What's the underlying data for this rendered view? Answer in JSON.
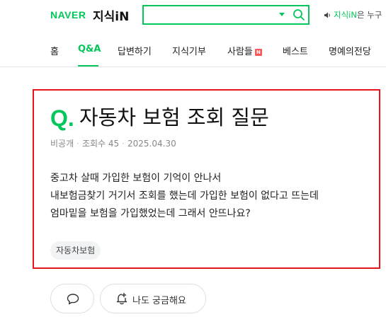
{
  "header": {
    "logo_brand": "NAVER",
    "logo_service": "지식iN",
    "search": {
      "value": "",
      "placeholder": ""
    },
    "notice": {
      "part1": "지식iN",
      "part2": "은 누구"
    }
  },
  "nav": {
    "items": [
      {
        "label": "홈",
        "active": false
      },
      {
        "label": "Q&A",
        "active": true
      },
      {
        "label": "답변하기",
        "active": false
      },
      {
        "label": "지식기부",
        "active": false
      },
      {
        "label": "사람들",
        "active": false,
        "badge": "N"
      },
      {
        "label": "베스트",
        "active": false
      },
      {
        "label": "명예의전당",
        "active": false
      }
    ]
  },
  "question": {
    "mark": "Q.",
    "title": "자동차 보험 조회 질문",
    "meta": {
      "author": "비공개",
      "views": "조회수 45",
      "date": "2025.04.30"
    },
    "body": "중고차 살때 가입한 보험이 기억이 안나서\n내보험금찾기 거기서 조회를 했는데 가입한 보험이 없다고 뜨는데\n엄마밑을 보험을 가입했었는데 그래서 안뜨나요?",
    "tag": "자동차보험"
  },
  "actions": {
    "curious_label": "나도 궁금해요"
  },
  "colors": {
    "brand_green": "#03c75a",
    "highlight_border": "#e8141b",
    "new_badge": "#fa5858"
  },
  "icons": {
    "search": "search-icon",
    "speaker": "speaker-icon",
    "comment": "comment-icon",
    "curious": "bell-plus-icon"
  }
}
